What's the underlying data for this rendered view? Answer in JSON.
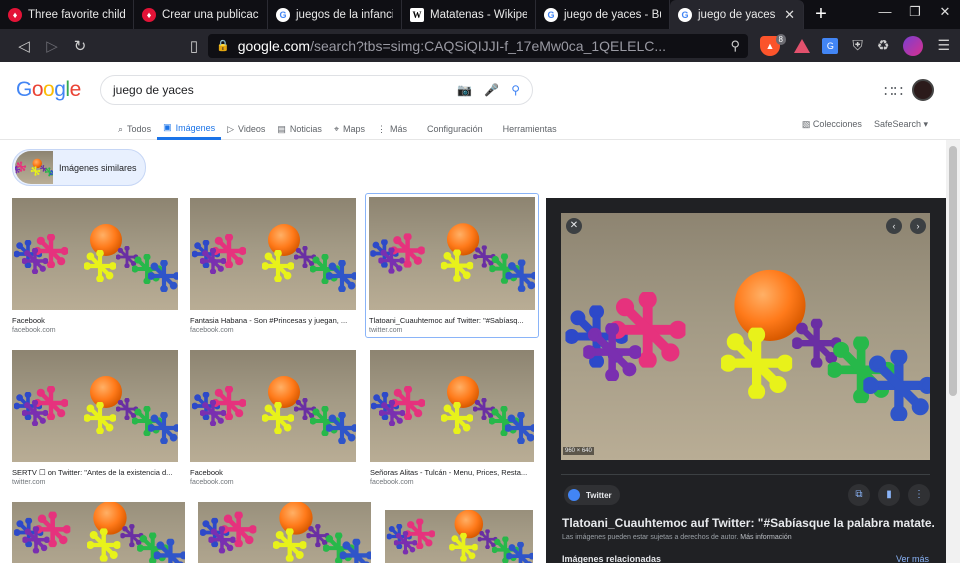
{
  "tabs": [
    {
      "label": "Three favorite childho",
      "favicon": "hive-icon",
      "active": false
    },
    {
      "label": "Crear una publicación",
      "favicon": "hive-icon",
      "active": false
    },
    {
      "label": "juegos de la infancia",
      "favicon": "google-icon",
      "active": false
    },
    {
      "label": "Matatenas - Wikipedia",
      "favicon": "wikipedia-icon",
      "active": false
    },
    {
      "label": "juego de yaces - Búsq",
      "favicon": "google-icon",
      "active": false
    },
    {
      "label": "juego de yaces -",
      "favicon": "google-icon",
      "active": true
    }
  ],
  "address": {
    "host": "google.com",
    "path": "/search?tbs=simg:CAQSiQIJJI-f_17eMw0ca_1QELELC...",
    "shield_count": "8"
  },
  "google": {
    "logo": [
      "G",
      "o",
      "o",
      "g",
      "l",
      "e"
    ],
    "query": "juego de yaces",
    "tabs": [
      {
        "icon": "search-icon",
        "glyph": "⌕",
        "label": "Todos",
        "active": false
      },
      {
        "icon": "image-icon",
        "glyph": "▣",
        "label": "Imágenes",
        "active": true
      },
      {
        "icon": "video-icon",
        "glyph": "▷",
        "label": "Videos",
        "active": false
      },
      {
        "icon": "news-icon",
        "glyph": "▤",
        "label": "Noticias",
        "active": false
      },
      {
        "icon": "maps-icon",
        "glyph": "⌖",
        "label": "Maps",
        "active": false
      },
      {
        "icon": "more-icon",
        "glyph": "⋮",
        "label": "Más",
        "active": false
      },
      {
        "icon": "",
        "glyph": "",
        "label": "Configuración",
        "active": false
      },
      {
        "icon": "",
        "glyph": "",
        "label": "Herramientas",
        "active": false
      }
    ],
    "collections": "Colecciones",
    "safesearch": "SafeSearch"
  },
  "similar_label": "Imágenes similares",
  "results": [
    {
      "caption": "Facebook",
      "source": "facebook.com"
    },
    {
      "caption": "Fantasia Habana - Son #Princesas y juegan, ...",
      "source": "facebook.com"
    },
    {
      "caption": "Tlatoani_Cuauhtemoc auf Twitter: \"#Sabíasq...",
      "source": "twitter.com"
    },
    {
      "caption": "SERTV ☐ on Twitter: \"Antes de la existencia d...",
      "source": "twitter.com"
    },
    {
      "caption": "Facebook",
      "source": "facebook.com"
    },
    {
      "caption": "Señoras Alitas - Tulcán - Menu, Prices, Resta...",
      "source": "facebook.com"
    },
    {
      "caption": "",
      "source": ""
    },
    {
      "caption": "",
      "source": ""
    },
    {
      "caption": "",
      "source": ""
    }
  ],
  "panel": {
    "dimensions": "960 × 640",
    "source_chip": "Twitter",
    "title": "Tlatoani_Cuauhtemoc auf Twitter: \"#Sabíasque la palabra matate...",
    "note": "Las imágenes pueden estar sujetas a derechos de autor.",
    "note_link": "Más información",
    "related": "Imágenes relacionadas",
    "see_more": "Ver más"
  },
  "colors": {
    "accent": "#1a73e8",
    "panel_bg": "#202124"
  }
}
